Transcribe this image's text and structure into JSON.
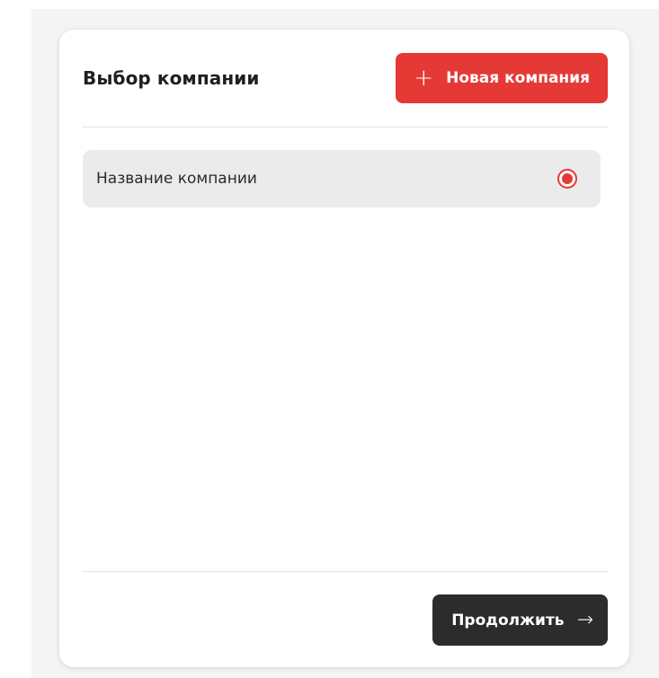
{
  "header": {
    "title": "Выбор компании",
    "new_company_button": {
      "icon": "plus-icon",
      "label": "Новая компания"
    }
  },
  "companies": [
    {
      "name": "Название компании",
      "selected": true
    }
  ],
  "footer": {
    "continue_button": {
      "label": "Продолжить",
      "icon": "arrow-right-icon"
    }
  },
  "colors": {
    "accent": "#e53935",
    "dark_button": "#2c2c2c",
    "item_background": "#ebebeb"
  }
}
